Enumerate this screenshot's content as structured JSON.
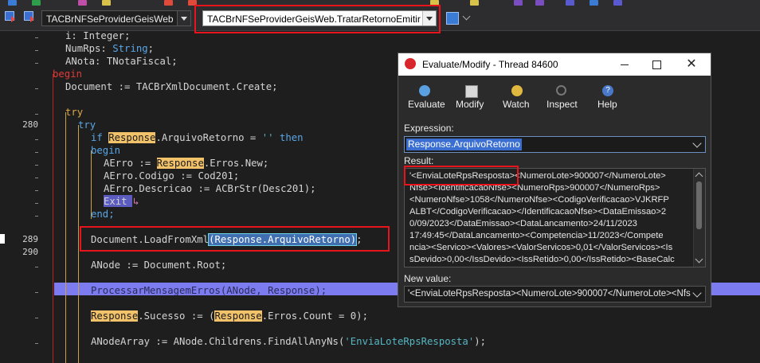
{
  "toolbar": {
    "unit_combo": "TACBrNFSeProviderGeisWeb",
    "method_combo": "TACBrNFSeProviderGeisWeb.TratarRetornoEmitir"
  },
  "gutter": {
    "lines": [
      "280",
      "289",
      "290"
    ]
  },
  "code": {
    "l1": "i: Integer;",
    "l2a": "NumRps: ",
    "l2b": "String",
    "l2c": ";",
    "l3": "ANota: TNotaFiscal;",
    "l4": "begin",
    "l5": "Document := TACBrXmlDocument.Create;",
    "l6": "try",
    "l7": "try",
    "l8_kw1": "if",
    "l8_hl": "Response",
    "l8_mid": ".ArquivoRetorno = ",
    "l8_str": "''",
    "l8_kw2": "then",
    "l9": "begin",
    "l10a": "AErro := ",
    "l10_hl": "Response",
    "l10b": ".Erros.New;",
    "l11": "AErro.Codigo := Cod201;",
    "l12": "AErro.Descricao := ACBrStr(Desc201);",
    "l13": "Exit",
    "l14": "end;",
    "l15a": "Document.LoadFromXml",
    "l15_sel": "(Response.ArquivoRetorno)",
    "l15b": ";",
    "l16": "ANode := Document.Root;",
    "l17": "ProcessarMensagemErros(ANode, Response);",
    "l18_hl": "Response",
    "l18a": ".Sucesso := ",
    "l18b": "(",
    "l18_hl2": "Response",
    "l18c": ".Erros.Count = 0);",
    "l19a": "ANodeArray := ANode.Childrens.FindAllAnyNs(",
    "l19_str": "'EnviaLoteRpsResposta'",
    "l19b": ");"
  },
  "dialog": {
    "title": "Evaluate/Modify - Thread 84600",
    "buttons": {
      "evaluate": "Evaluate",
      "modify": "Modify",
      "watch": "Watch",
      "inspect": "Inspect",
      "help": "Help"
    },
    "expression_label": "Expression:",
    "expression_value": "Response.ArquivoRetorno",
    "result_label": "Result:",
    "result_lines": [
      "'<EnviaLoteRpsResposta><NumeroLote>900007</NumeroLote>",
      "Nfse><IdentificacaoNfse><NumeroRps>900007</NumeroRps>",
      "<NumeroNfse>1058</NumeroNfse><CodigoVerificacao>VJKRFP",
      "ALBT</CodigoVerificacao></IdentificacaoNfse><DataEmissao>2",
      "0/09/2023</DataEmissao><DataLancamento>24/11/2023",
      "17:49:45</DataLancamento><Competencia>11/2023</Compete",
      "ncia><Servico><Valores><ValorServicos>0,01</ValorServicos><Is",
      "sDevido>0,00</IssDevido><IssRetido>0,00</IssRetido><BaseCalc"
    ],
    "new_value_label": "New value:",
    "new_value": "'<EnviaLoteRpsResposta><NumeroLote>900007</NumeroLote><Nfse>"
  },
  "colors": {
    "highlight_box": "#e8141b",
    "exec_line": "#7c7cf0",
    "keyword": "#59a7e8",
    "identifier_highlight": "#f2c26b"
  }
}
